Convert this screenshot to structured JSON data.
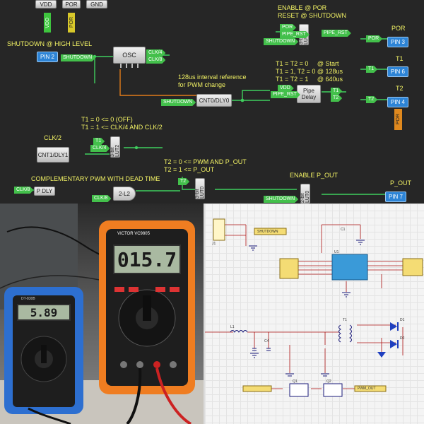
{
  "panels": {
    "logic_editor": {
      "top_labels": [
        "VDD",
        "POR",
        "GND"
      ],
      "top_tags": [
        "VDD",
        "POR"
      ],
      "annotations": {
        "shutdown": "SHUTDOWN @ HIGH LEVEL",
        "enable_por": "ENABLE @ POR\nRESET @ SHUTDOWN",
        "interval": "128us interval reference\nfor PWM change",
        "t_table": "T1 = T2 = 0     @ Start\nT1 = 1, T2 = 0 @ 128us\nT1 = T2 = 1     @ 640us",
        "clk2": "CLK/2",
        "t1_rule": "T1 = 0 <= 0 (OFF)\nT1 = 1 <= CLK/4 AND CLK/2",
        "t2_rule": "T2 = 0 <= PWM AND P_OUT\nT2 = 1 <= P_OUT",
        "pwm": "COMPLEMENTARY PWM WITH DEAD TIME",
        "enable_pout": "ENABLE P_OUT"
      },
      "output_titles": {
        "por": "POR",
        "t1": "T1",
        "t2": "T2",
        "pout": "P_OUT"
      },
      "pins": {
        "pin2": "PIN 2",
        "pin3": "PIN 3",
        "pin6": "PIN 6",
        "pin4": "PIN 4",
        "pin7": "PIN 7"
      },
      "blocks": {
        "osc": "OSC",
        "cnt0": "CNT0/DLY0",
        "cnt1": "CNT1/DLY1",
        "pipe": "Pipe\nDelay",
        "pdly": "P DLY",
        "l2": "2-L2",
        "lut3": "3-bit\nLUT3",
        "lut2": "3-bit\nLUT2",
        "lut0_3": "3-bit\nLUT0",
        "lut0_2": "2-bit\nLUT0"
      },
      "tags": {
        "shutdown": "SHUTDOWN",
        "clk4": "CLK/4",
        "clk8": "CLK/8",
        "por": "POR",
        "pipe_rst": "PIPE_RST",
        "vdd": "VDD",
        "t1": "T1",
        "t2": "T2",
        "t1_tag": "T1",
        "clk4b": "CLK/4",
        "clk8b": "CLK/8",
        "clk8c": "CLK/8",
        "pout_tag": "P_OUT"
      },
      "colors": {
        "background": "#262626",
        "annotation": "#f1f164",
        "pin": "#2d84d6",
        "signal": "#43c04b",
        "wire": "#3fcf5e",
        "osc_wire": "#e07b1a",
        "vdd_tag": "#3ec53e",
        "por_tag": "#d8c82a"
      }
    },
    "photo": {
      "small_meter_reading": "5.89",
      "large_meter_reading": "015.7",
      "large_meter_brand": "VICTOR VC9805",
      "small_meter_brand": "DT-830B"
    },
    "schematic": {
      "labels": [
        "J1",
        "U1",
        "C1",
        "C4",
        "L1",
        "T1",
        "D1",
        "D2",
        "Q1",
        "Q2",
        "SHUTDOWN",
        "PWM_OUT"
      ]
    }
  }
}
